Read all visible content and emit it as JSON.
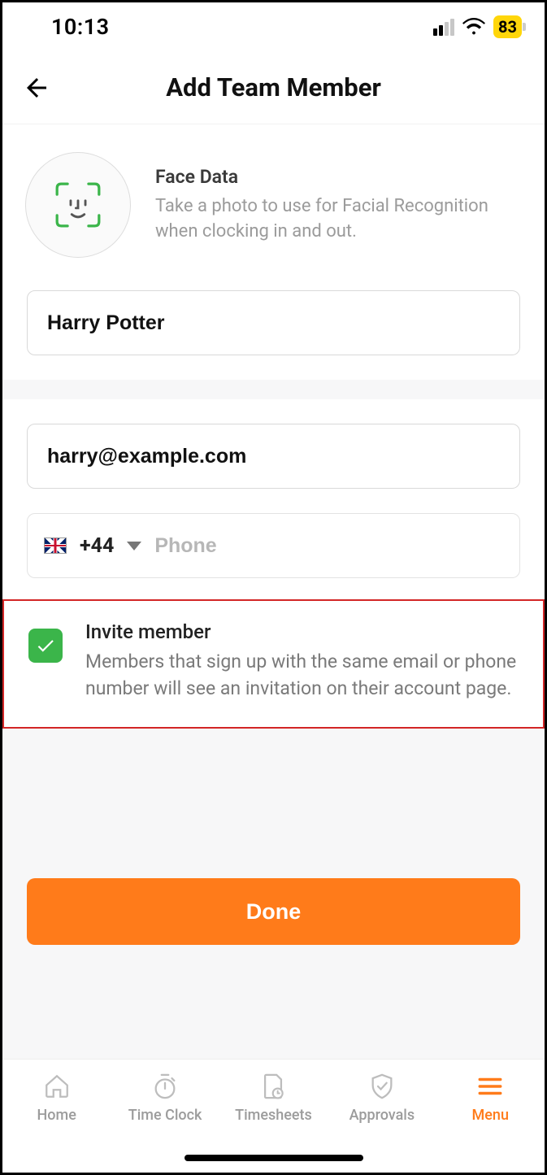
{
  "status": {
    "time": "10:13",
    "battery": "83"
  },
  "header": {
    "title": "Add Team Member"
  },
  "face": {
    "title": "Face Data",
    "desc": "Take a photo to use for Facial Recognition when clocking in and out."
  },
  "form": {
    "name_value": "Harry Potter",
    "email_value": "harry@example.com",
    "country_code": "+44",
    "phone_placeholder": "Phone"
  },
  "invite": {
    "checked": true,
    "title": "Invite member",
    "desc": "Members that sign up with the same email or phone number will see an invitation on their account page."
  },
  "actions": {
    "done_label": "Done"
  },
  "tabs": {
    "items": [
      {
        "label": "Home",
        "icon": "home-icon"
      },
      {
        "label": "Time Clock",
        "icon": "stopwatch-icon"
      },
      {
        "label": "Timesheets",
        "icon": "document-clock-icon"
      },
      {
        "label": "Approvals",
        "icon": "shield-check-icon"
      },
      {
        "label": "Menu",
        "icon": "menu-icon"
      }
    ],
    "active_index": 4
  }
}
